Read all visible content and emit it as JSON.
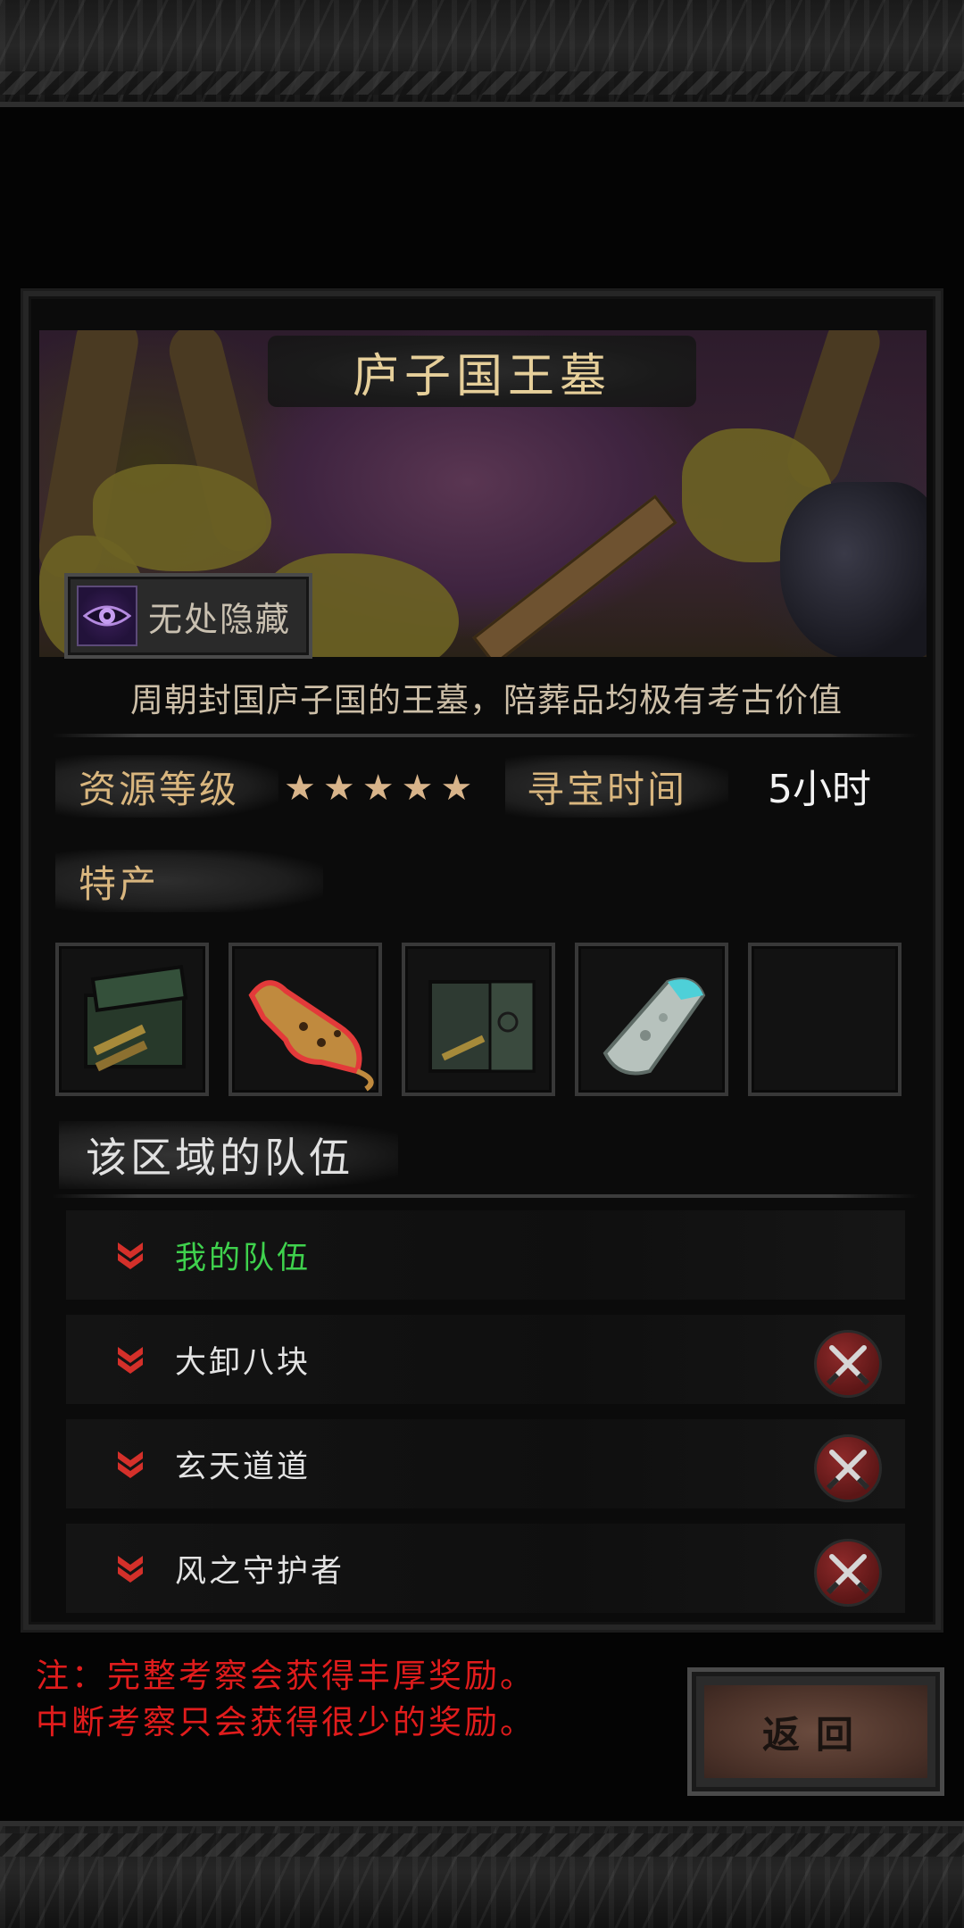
{
  "location": {
    "name": "庐子国王墓",
    "trait_label": "无处隐藏",
    "trait_icon": "eye-icon",
    "description": "周朝封国庐子国的王墓，陪葬品均极有考古价值"
  },
  "stats": {
    "resource_level_label": "资源等级",
    "resource_level_stars": 5,
    "resource_level_max": 5,
    "treasure_time_label": "寻宝时间",
    "treasure_time_value": "5小时"
  },
  "specialty": {
    "label": "特产",
    "items": [
      {
        "icon": "green-chest-icon"
      },
      {
        "icon": "golden-leopard-icon",
        "rare": true
      },
      {
        "icon": "open-crate-icon"
      },
      {
        "icon": "jade-shard-icon"
      },
      {
        "icon": "empty-slot"
      }
    ]
  },
  "teams": {
    "header": "该区域的队伍",
    "rows": [
      {
        "name": "我的队伍",
        "mine": true
      },
      {
        "name": "大卸八块",
        "mine": false
      },
      {
        "name": "玄天道道",
        "mine": false
      },
      {
        "name": "风之守护者",
        "mine": false
      }
    ]
  },
  "footer": {
    "note_line1": "注：完整考察会获得丰厚奖励。",
    "note_line2": "中断考察只会获得很少的奖励。",
    "back_label": "返回"
  },
  "colors": {
    "title_gold": "#e6cf9a",
    "label_gold": "#d9b67e",
    "my_team_green": "#3fd14d",
    "note_red": "#e01c1c"
  }
}
